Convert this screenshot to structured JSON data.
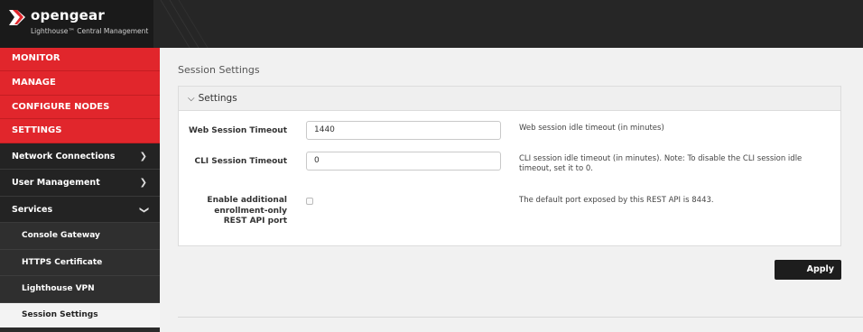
{
  "brand": {
    "name": "opengear",
    "subtitle": "Lighthouse™ Central Management",
    "colors": {
      "red": "#e1262c",
      "dark": "#262626"
    }
  },
  "sidebar": {
    "red_items": [
      {
        "label": "MONITOR"
      },
      {
        "label": "MANAGE"
      },
      {
        "label": "CONFIGURE NODES"
      },
      {
        "label": "SETTINGS"
      }
    ],
    "dark_items": [
      {
        "label": "Network Connections",
        "icon": "chevron-right-icon"
      },
      {
        "label": "User Management",
        "icon": "chevron-right-icon"
      },
      {
        "label": "Services",
        "icon": "chevron-down-icon"
      }
    ],
    "sub_items": [
      {
        "label": "Console Gateway"
      },
      {
        "label": "HTTPS Certificate"
      },
      {
        "label": "Lighthouse VPN"
      },
      {
        "label": "Session Settings",
        "active": true
      }
    ]
  },
  "main": {
    "title": "Session Settings",
    "panel": {
      "header": "Settings",
      "fields": [
        {
          "label": "Web Session Timeout",
          "value": "1440",
          "help": "Web session idle timeout (in minutes)"
        },
        {
          "label": "CLI Session Timeout",
          "value": "0",
          "help": "CLI session idle timeout (in minutes). Note: To disable the CLI session idle timeout, set it to 0."
        },
        {
          "label": "Enable additional enrollment-only REST API port",
          "checked": false,
          "help": "The default port exposed by this REST API is 8443."
        }
      ]
    },
    "apply_label": "Apply"
  }
}
